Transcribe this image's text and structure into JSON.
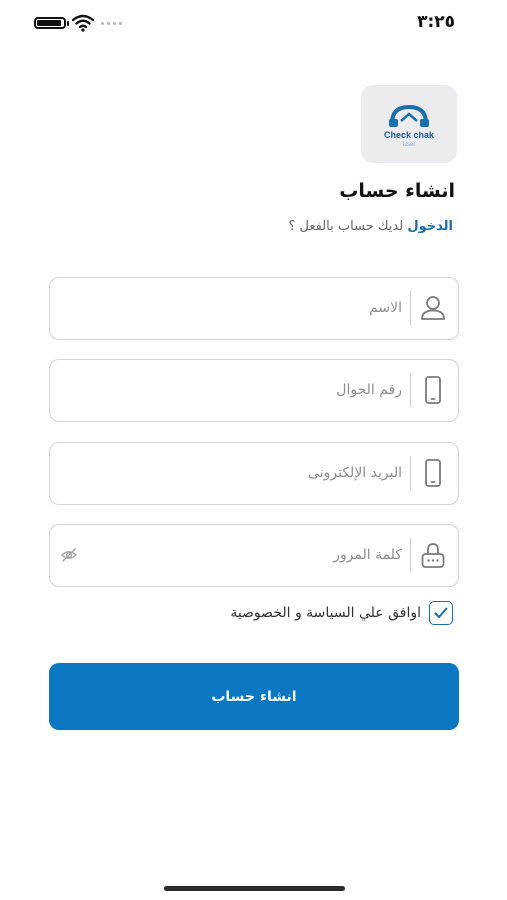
{
  "status_bar": {
    "time": "٣:٢٥"
  },
  "logo": {
    "brand": "Check chak",
    "tag": "User"
  },
  "form": {
    "title": "انشاء حساب",
    "login_prompt": "لديك حساب بالفعل ؟",
    "login_link": "الدخول",
    "fields": {
      "name": {
        "placeholder": "الاسم",
        "value": ""
      },
      "phone": {
        "placeholder": "رقم الجوال",
        "value": ""
      },
      "email": {
        "placeholder": "البريد الإلكترونى",
        "value": ""
      },
      "password": {
        "placeholder": "كلمة المرور",
        "value": ""
      }
    },
    "terms_label": "اوافق علي السياسة و الخصوصية",
    "terms_checked": true,
    "submit_label": "انشاء حساب"
  },
  "colors": {
    "accent": "#0a77c2",
    "link": "#1a6fae",
    "field_border": "#d4d4d4",
    "logo_bg": "#ececee"
  },
  "icons": {
    "name": "user-icon",
    "phone": "phone-icon",
    "email": "phone-icon",
    "password": "lock-icon",
    "password_toggle": "eye-off-icon",
    "terms": "checkmark-icon"
  }
}
